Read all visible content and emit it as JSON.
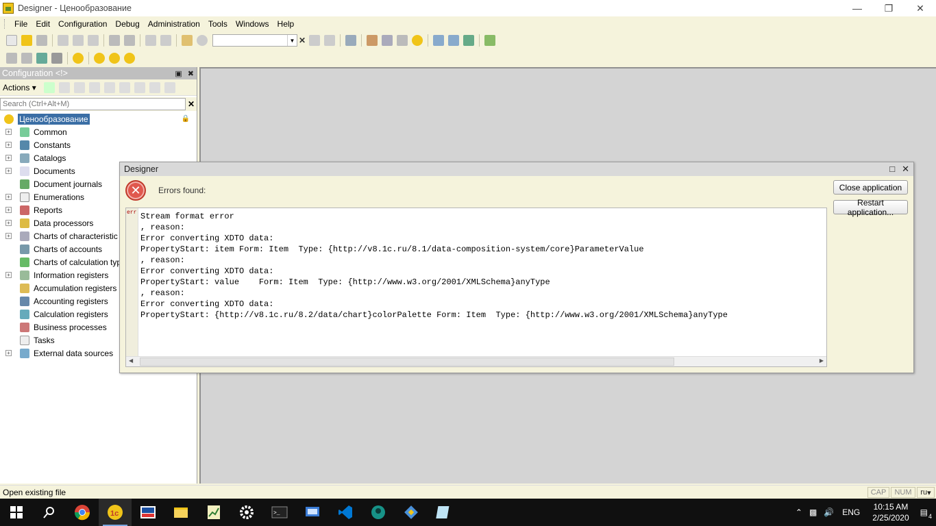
{
  "window": {
    "title": "Designer - Ценообразование"
  },
  "menu": [
    "File",
    "Edit",
    "Configuration",
    "Debug",
    "Administration",
    "Tools",
    "Windows",
    "Help"
  ],
  "panel": {
    "title": "Configuration <!>",
    "actions_label": "Actions",
    "search_placeholder": "Search (Ctrl+Alt+M)",
    "root": "Ценообразование",
    "items": [
      {
        "label": "Common",
        "expandable": true
      },
      {
        "label": "Constants",
        "expandable": true
      },
      {
        "label": "Catalogs",
        "expandable": true
      },
      {
        "label": "Documents",
        "expandable": true
      },
      {
        "label": "Document journals",
        "expandable": false
      },
      {
        "label": "Enumerations",
        "expandable": true
      },
      {
        "label": "Reports",
        "expandable": true
      },
      {
        "label": "Data processors",
        "expandable": true
      },
      {
        "label": "Charts of characteristic types",
        "expandable": true
      },
      {
        "label": "Charts of accounts",
        "expandable": false
      },
      {
        "label": "Charts of calculation types",
        "expandable": false
      },
      {
        "label": "Information registers",
        "expandable": true
      },
      {
        "label": "Accumulation registers",
        "expandable": false
      },
      {
        "label": "Accounting registers",
        "expandable": false
      },
      {
        "label": "Calculation registers",
        "expandable": false
      },
      {
        "label": "Business processes",
        "expandable": false
      },
      {
        "label": "Tasks",
        "expandable": false
      },
      {
        "label": "External data sources",
        "expandable": true
      }
    ]
  },
  "dialog": {
    "title": "Designer",
    "errors_label": "Errors found:",
    "gutter_tag": "err",
    "log": "Stream format error\n, reason:\nError converting XDTO data:\nPropertyStart: item Form: Item  Type: {http://v8.1c.ru/8.1/data-composition-system/core}ParameterValue\n, reason:\nError converting XDTO data:\nPropertyStart: value    Form: Item  Type: {http://www.w3.org/2001/XMLSchema}anyType\n, reason:\nError converting XDTO data:\nPropertyStart: {http://v8.1c.ru/8.2/data/chart}colorPalette Form: Item  Type: {http://www.w3.org/2001/XMLSchema}anyType",
    "close_button": "Close application",
    "restart_button": "Restart application..."
  },
  "status": {
    "text": "Open existing file",
    "cap": "CAP",
    "num": "NUM",
    "lang": "ru"
  },
  "taskbar": {
    "lang": "ENG",
    "time": "10:15 AM",
    "date": "2/25/2020",
    "notifications": "4"
  },
  "colors": {
    "chrome": "#f5f3dc",
    "workarea": "#d4d4d4",
    "selection": "#3a6ea5",
    "error": "#e0584e"
  }
}
